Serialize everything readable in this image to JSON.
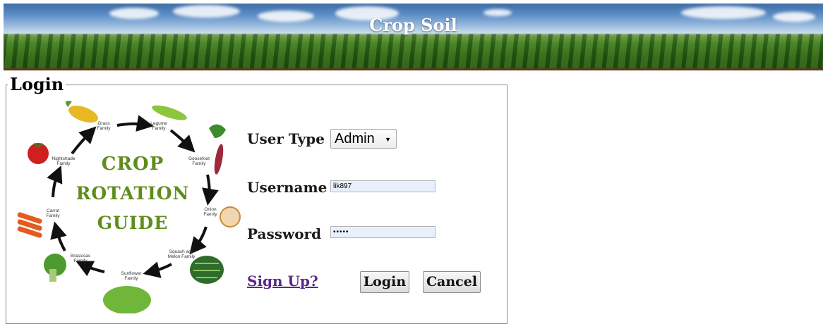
{
  "header": {
    "title": "Crop Soil"
  },
  "login": {
    "legend": "Login"
  },
  "guide": {
    "title_lines": [
      "CROP",
      "ROTATION",
      "GUIDE"
    ],
    "families": {
      "grass": "Grass Family",
      "legume": "Legume Family",
      "goosefoot": "Goosefoot Family",
      "onion": "Onion Family",
      "squash": "Squash and Melon Family",
      "sunflower": "Sunflower Family",
      "brassicas": "Brassicas Family",
      "carrot": "Carrot Family",
      "nightshade": "Nightshade Family"
    }
  },
  "form": {
    "user_type_label": "User Type",
    "user_type_value": "Admin",
    "username_label": "Username",
    "username_value": "lik897",
    "password_label": "Password",
    "password_masked": "•••••",
    "signup_label": "Sign Up?",
    "login_button": "Login",
    "cancel_button": "Cancel"
  },
  "colors": {
    "guide_title": "#5f8d1b",
    "signup_link": "#5a2a8a",
    "field_fill": "#e8f0fe"
  }
}
